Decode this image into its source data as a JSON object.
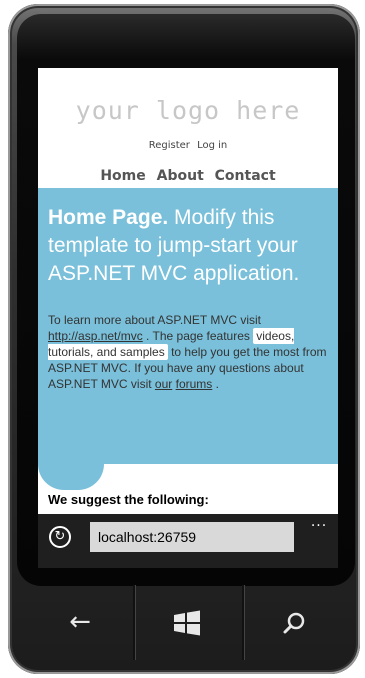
{
  "page": {
    "logo": "your logo here",
    "login_links": [
      "Register",
      "Log in"
    ],
    "nav": [
      "Home",
      "About",
      "Contact"
    ],
    "featured": {
      "title_bold": "Home Page.",
      "title_rest": " Modify this template to jump-start your ASP.NET MVC application.",
      "body": {
        "p1": "To learn more about ASP.NET MVC visit ",
        "link1": "http://asp.net/mvc",
        "p2": " . The page features ",
        "highlight": "videos, tutorials, and samples",
        "p3": " to help you get the most from ASP.NET MVC. If you have any questions about ASP.NET MVC visit ",
        "link2_a": "our",
        "link2_b": "forums",
        "p4": " ."
      }
    },
    "suggest_heading": "We suggest the following:"
  },
  "browser": {
    "address": "localhost:26759",
    "more": "..."
  },
  "hardware_buttons": {
    "back": "back-icon",
    "start": "windows-start-icon",
    "search": "search-icon"
  },
  "colors": {
    "featured_bg": "#7ac0da",
    "logo_text": "#c7c7c7",
    "browser_bar": "#1f1f1f",
    "address_bg": "#d9d9d9"
  }
}
